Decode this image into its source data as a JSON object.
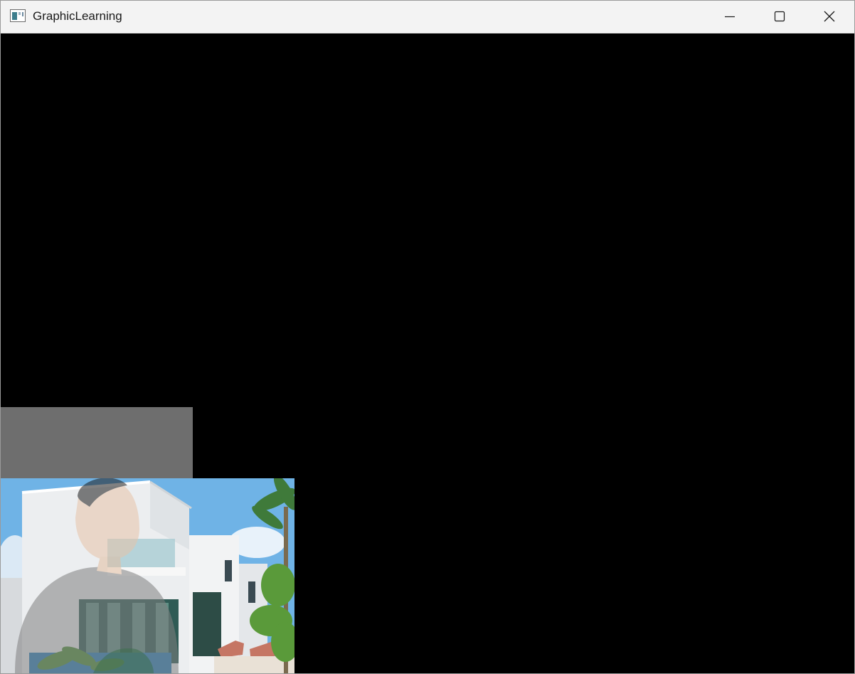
{
  "window": {
    "title": "GraphicLearning",
    "icon": "app-window-icon",
    "controls": {
      "minimize": "minimize-icon",
      "maximize": "maximize-icon",
      "close": "close-icon"
    }
  },
  "colors": {
    "titlebar_bg": "#f3f3f3",
    "canvas_bg": "#000000",
    "gray_quad": "#6e6e6e"
  }
}
